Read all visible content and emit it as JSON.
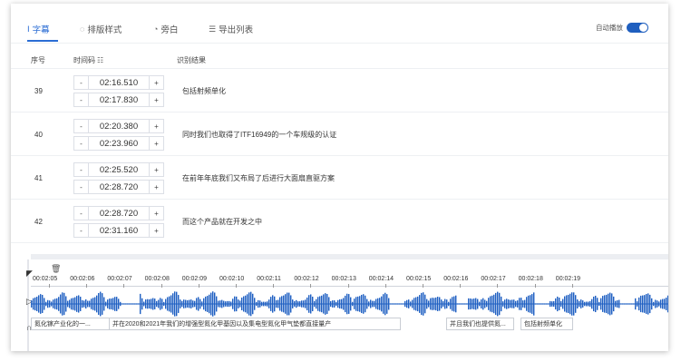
{
  "tabs": [
    {
      "label": "字幕",
      "icon": "subtitle-icon",
      "active": true
    },
    {
      "label": "排版样式",
      "icon": "palette-icon",
      "active": false
    },
    {
      "label": "旁白",
      "icon": "narration-icon",
      "active": false
    },
    {
      "label": "导出列表",
      "icon": "list-icon",
      "active": false
    }
  ],
  "autoplay": {
    "label": "自动播放",
    "enabled": true
  },
  "table": {
    "headers": {
      "index": "序号",
      "timecode": "时间码",
      "result": "识别结果"
    },
    "rows": [
      {
        "index": "39",
        "start": "02:16.510",
        "end": "02:17.830",
        "text": "包括射频单化"
      },
      {
        "index": "40",
        "start": "02:20.380",
        "end": "02:23.960",
        "text": "同时我们也取得了ITF16949的一个车规级的认证"
      },
      {
        "index": "41",
        "start": "02:25.520",
        "end": "02:28.720",
        "text": "在前年年底我们又布局了后进行大面扇直驱方案"
      },
      {
        "index": "42",
        "start": "02:28.720",
        "end": "02:31.160",
        "text": "而这个产品就在开发之中"
      }
    ],
    "minus": "-",
    "plus": "+"
  },
  "timeline": {
    "ticks": [
      "00:02:05",
      "00:02:06",
      "00:02:07",
      "00:02:08",
      "00:02:09",
      "00:02:10",
      "00:02:11",
      "00:02:12",
      "00:02:13",
      "00:02:14",
      "00:02:15",
      "00:02:16",
      "00:02:17",
      "00:02:18",
      "00:02:19"
    ],
    "segments": [
      "氮化镓产业化的一...",
      "并在2020和2021年我们的增强型氮化甲基因以及集电型氮化甲气垫都直接量产",
      "并且我们也提供氮...",
      "包括射频单化"
    ],
    "wave_color": "#1e5fc2"
  }
}
